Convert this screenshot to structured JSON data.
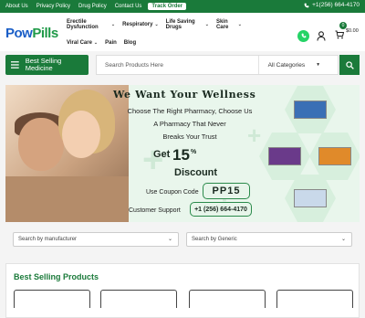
{
  "topbar": {
    "links": [
      "About Us",
      "Privacy Policy",
      "Drug Policy",
      "Contact Us"
    ],
    "track_order": "Track Order",
    "phone": "+1(256) 664-4170"
  },
  "brand": {
    "logo_part1": "Pow",
    "logo_part2": "Pills"
  },
  "nav": {
    "row1": [
      {
        "label": "Erectile Dysfunction",
        "has_menu": true
      },
      {
        "label": "Respiratory",
        "has_menu": true
      },
      {
        "label": "Life Saving Drugs",
        "has_menu": true
      },
      {
        "label": "Skin Care",
        "has_menu": true
      }
    ],
    "row2": [
      {
        "label": "Viral Care",
        "has_menu": true
      },
      {
        "label": "Pain",
        "has_menu": false
      },
      {
        "label": "Blog",
        "has_menu": false
      }
    ]
  },
  "header_icons": {
    "cart_count": "0",
    "cart_total": "$0.00"
  },
  "category_button": {
    "label": "Best Selling Medicine"
  },
  "search": {
    "placeholder": "Search Products Here",
    "category": "All Categories"
  },
  "banner": {
    "headline": "We Want Your Wellness",
    "line1": "Choose The Right Pharmacy, Choose Us",
    "line2": "A Pharmacy That Never",
    "line3": "Breaks Your Trust",
    "get": "Get",
    "discount_value": "15",
    "discount_unit": "%",
    "discount_label": "Discount",
    "coupon_text": "Use Coupon Code",
    "coupon_code": "PP15",
    "support_text": "Customer Support",
    "support_phone": "+1 (256) 664-4170"
  },
  "filters": {
    "manufacturer": "Search by manufacturer",
    "generic": "Search by Generic"
  },
  "section": {
    "title": "Best Selling Products"
  },
  "colors": {
    "brand_green": "#1a7a3a",
    "logo_blue": "#1a5ec7",
    "whatsapp": "#25d366"
  }
}
